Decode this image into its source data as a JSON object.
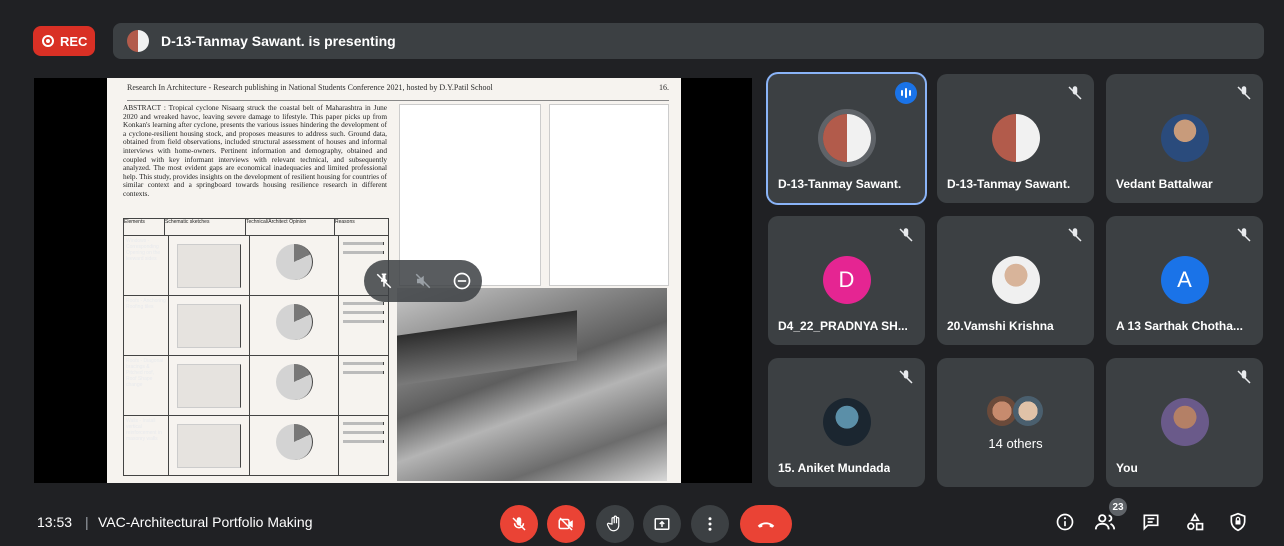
{
  "header": {
    "rec_label": "REC",
    "presenter_text": "D-13-Tanmay Sawant. is presenting"
  },
  "document": {
    "running_head": "Research In Architecture - Research publishing in National Students Conference 2021, hosted by D.Y.Patil School",
    "page_number": "16.",
    "abstract": "ABSTRACT : Tropical cyclone Nisaarg struck the coastal belt of Maharashtra in June 2020 and wreaked havoc, leaving severe damage to lifestyle. This paper picks up from Konkan's learning after cyclone, presents the various issues hindering the development of a cyclone-resilient housing stock, and proposes measures to address such. Ground data, obtained from field observations, included structural assessment of houses and informal interviews with home-owners. Pertinent information and demography, obtained and coupled with key informant interviews with relevant technical, and subsequently analyzed. The most evident gaps are economical inadequacies and limited professional help. This study, provides insights on the development of resilient housing for countries of similar context and a springboard towards housing resilience research in different contexts.",
    "table_headers": [
      "Elements",
      "Schematic sketches",
      "Technical/Architect Opinion",
      "Reasons"
    ],
    "table_rows": [
      "Windows - Corresponding Opening on the leeward sides",
      "Roofs - Anchoring Roofing tiles",
      "Roofs - Diagonal bracings & Pitched roof, Roof Shape change",
      "Walls - Install vertical reinforcement in masonry walls"
    ]
  },
  "participants": [
    {
      "name": "D-13-Tanmay Sawant.",
      "initial": "",
      "avatar": "photo-split",
      "color": "",
      "speaking": true
    },
    {
      "name": "D-13-Tanmay Sawant.",
      "initial": "",
      "avatar": "photo-split",
      "color": "",
      "speaking": false
    },
    {
      "name": "Vedant Battalwar",
      "initial": "",
      "avatar": "photo-person",
      "color": "",
      "speaking": false
    },
    {
      "name": "D4_22_PRADNYA SH...",
      "initial": "D",
      "avatar": "letter",
      "color": "#e52592",
      "speaking": false
    },
    {
      "name": "20.Vamshi Krishna",
      "initial": "",
      "avatar": "photo-person",
      "color": "",
      "speaking": false
    },
    {
      "name": "A 13 Sarthak Chotha...",
      "initial": "A",
      "avatar": "letter",
      "color": "#1a73e8",
      "speaking": false
    },
    {
      "name": "15. Aniket Mundada",
      "initial": "",
      "avatar": "photo-dark",
      "color": "",
      "speaking": false
    },
    {
      "name": "",
      "others": "14 others",
      "avatar": "group",
      "color": "",
      "speaking": false
    },
    {
      "name": "You",
      "initial": "",
      "avatar": "photo-person",
      "color": "",
      "speaking": false
    }
  ],
  "bottom": {
    "time": "13:53",
    "separator": "|",
    "meeting_title": "VAC-Architectural Portfolio Making",
    "people_count": "23"
  },
  "colors": {
    "bg": "#202124",
    "tile": "#3c4043",
    "red": "#ea4335",
    "accent": "#8ab4f8"
  }
}
